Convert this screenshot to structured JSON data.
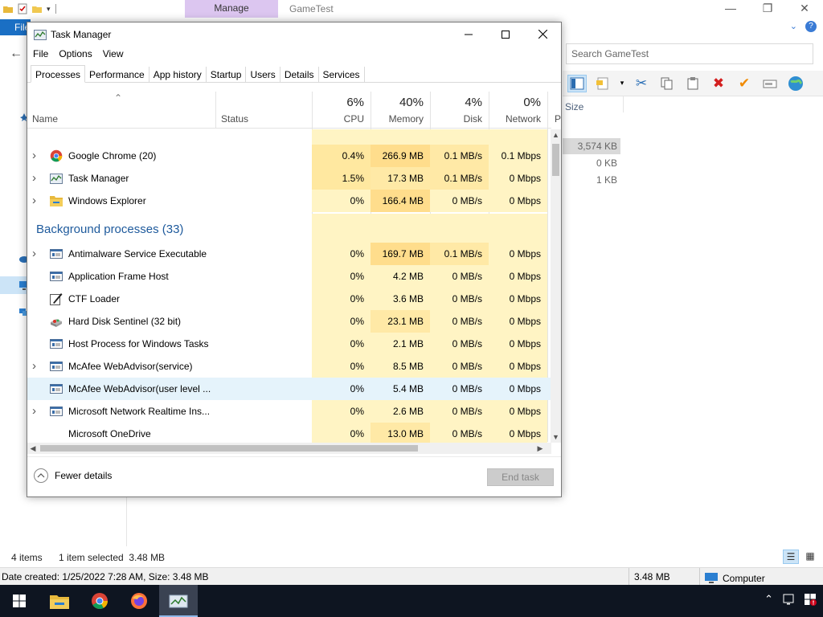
{
  "explorer": {
    "manage_tab": "Manage",
    "title": "GameTest",
    "file_tab": "File",
    "search_placeholder": "Search GameTest",
    "column_size": "Size",
    "sizes": [
      "3,574 KB",
      "0 KB",
      "1 KB"
    ],
    "status": {
      "items": "4 items",
      "selected": "1 item selected  3.48 MB"
    },
    "details": {
      "date_info": "Date created: 1/25/2022 7:28 AM, Size: 3.48 MB",
      "size": "3.48 MB",
      "location": "Computer"
    }
  },
  "task_manager": {
    "title": "Task Manager",
    "menu": [
      "File",
      "Options",
      "View"
    ],
    "tabs": [
      "Processes",
      "Performance",
      "App history",
      "Startup",
      "Users",
      "Details",
      "Services"
    ],
    "active_tab": "Processes",
    "columns": {
      "name": "Name",
      "status": "Status",
      "cpu": {
        "pct": "6%",
        "label": "CPU"
      },
      "memory": {
        "pct": "40%",
        "label": "Memory"
      },
      "disk": {
        "pct": "4%",
        "label": "Disk"
      },
      "network": {
        "pct": "0%",
        "label": "Network"
      },
      "power": "P"
    },
    "apps": [
      {
        "name": "Google Chrome (20)",
        "icon": "chrome-icon",
        "expandable": true,
        "cpu": "0.4%",
        "memory": "266.9 MB",
        "disk": "0.1 MB/s",
        "network": "0.1 Mbps"
      },
      {
        "name": "Task Manager",
        "icon": "task-manager-icon",
        "expandable": true,
        "cpu": "1.5%",
        "memory": "17.3 MB",
        "disk": "0.1 MB/s",
        "network": "0 Mbps"
      },
      {
        "name": "Windows Explorer",
        "icon": "folder-icon",
        "expandable": true,
        "cpu": "0%",
        "memory": "166.4 MB",
        "disk": "0 MB/s",
        "network": "0 Mbps"
      }
    ],
    "background_group": "Background processes (33)",
    "background": [
      {
        "name": "Antimalware Service Executable",
        "icon": "service-window-icon",
        "expandable": true,
        "cpu": "0%",
        "memory": "169.7 MB",
        "disk": "0.1 MB/s",
        "network": "0 Mbps"
      },
      {
        "name": "Application Frame Host",
        "icon": "service-window-icon",
        "expandable": false,
        "cpu": "0%",
        "memory": "4.2 MB",
        "disk": "0 MB/s",
        "network": "0 Mbps"
      },
      {
        "name": "CTF Loader",
        "icon": "pen-icon",
        "expandable": false,
        "cpu": "0%",
        "memory": "3.6 MB",
        "disk": "0 MB/s",
        "network": "0 Mbps"
      },
      {
        "name": "Hard Disk Sentinel (32 bit)",
        "icon": "hard-disk-icon",
        "expandable": false,
        "cpu": "0%",
        "memory": "23.1 MB",
        "disk": "0 MB/s",
        "network": "0 Mbps"
      },
      {
        "name": "Host Process for Windows Tasks",
        "icon": "service-window-icon",
        "expandable": false,
        "cpu": "0%",
        "memory": "2.1 MB",
        "disk": "0 MB/s",
        "network": "0 Mbps"
      },
      {
        "name": "McAfee WebAdvisor(service)",
        "icon": "service-window-icon",
        "expandable": true,
        "cpu": "0%",
        "memory": "8.5 MB",
        "disk": "0 MB/s",
        "network": "0 Mbps"
      },
      {
        "name": "McAfee WebAdvisor(user level ...",
        "icon": "service-window-icon",
        "expandable": false,
        "cpu": "0%",
        "memory": "5.4 MB",
        "disk": "0 MB/s",
        "network": "0 Mbps"
      },
      {
        "name": "Microsoft Network Realtime Ins...",
        "icon": "service-window-icon",
        "expandable": true,
        "cpu": "0%",
        "memory": "2.6 MB",
        "disk": "0 MB/s",
        "network": "0 Mbps"
      },
      {
        "name": "Microsoft OneDrive",
        "icon": "none",
        "expandable": false,
        "cpu": "0%",
        "memory": "13.0 MB",
        "disk": "0 MB/s",
        "network": "0 Mbps"
      }
    ],
    "footer": {
      "fewer_details": "Fewer details",
      "end_task": "End task"
    }
  },
  "colors": {
    "taskbar": "#0e1521",
    "group_heading": "#1e5a9c",
    "heat_pale": "#fff4c4",
    "heat_mid": "#ffe9a6",
    "heat_high": "#ffdd8c",
    "selection": "#e5f3fb"
  }
}
